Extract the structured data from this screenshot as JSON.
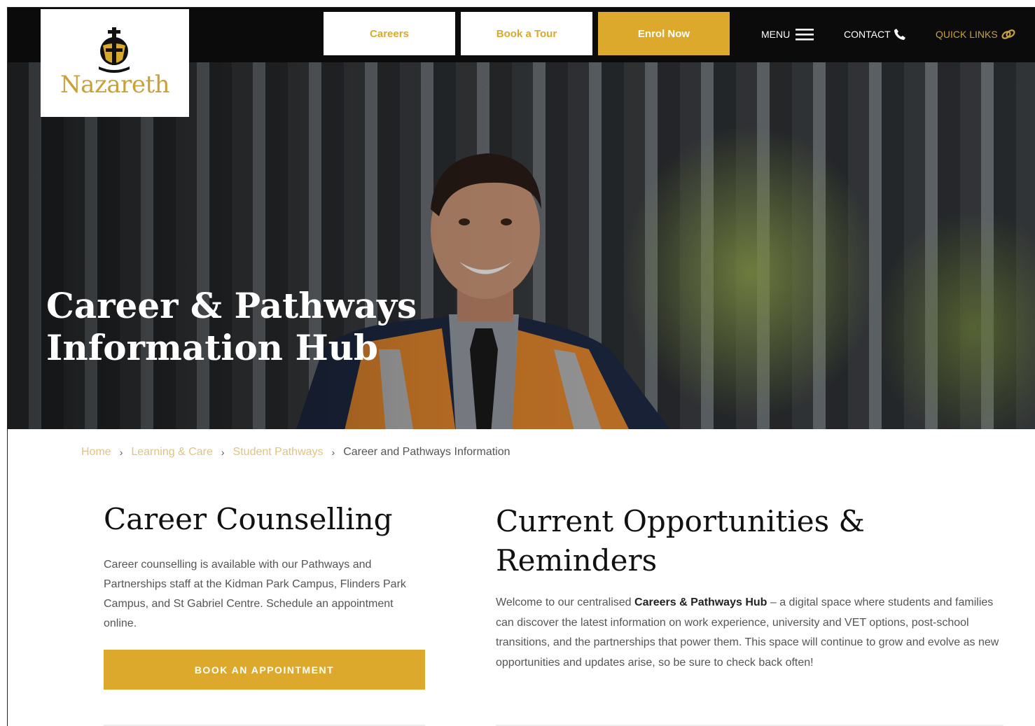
{
  "header": {
    "logo_text": "Nazareth",
    "buttons": {
      "careers": "Careers",
      "book_tour": "Book a Tour",
      "enrol": "Enrol Now"
    },
    "links": {
      "menu": "MENU",
      "contact": "CONTACT",
      "quick_links": "QUICK LINKS"
    },
    "icons": {
      "menu": "hamburger-icon",
      "contact": "phone-icon",
      "quick_links": "link-icon"
    }
  },
  "hero": {
    "title_line1": "Career & Pathways",
    "title_line2": "Information Hub"
  },
  "breadcrumb": {
    "items": [
      "Home",
      "Learning & Care",
      "Student Pathways"
    ],
    "current": "Career and Pathways Information"
  },
  "counselling": {
    "heading": "Career Counselling",
    "body": "Career counselling is available with our Pathways and Partnerships staff at the Kidman Park Campus, Flinders Park Campus, and St Gabriel Centre. Schedule an appointment online.",
    "button": "BOOK AN APPOINTMENT"
  },
  "opportunities": {
    "heading": "Current Opportunities & Reminders",
    "body_prefix": "Welcome to our centralised ",
    "body_bold": "Careers & Pathways Hub",
    "body_suffix": " – a digital space where students and families can discover the latest information on work experience, university and VET options, post-school transitions, and the partnerships that power them. This space will continue to grow and evolve as new opportunities and updates arise, so be sure to check back often!"
  },
  "colors": {
    "gold": "#dca92c",
    "logo_gold": "#c9a13b",
    "topbar": "#0b0b0b"
  }
}
